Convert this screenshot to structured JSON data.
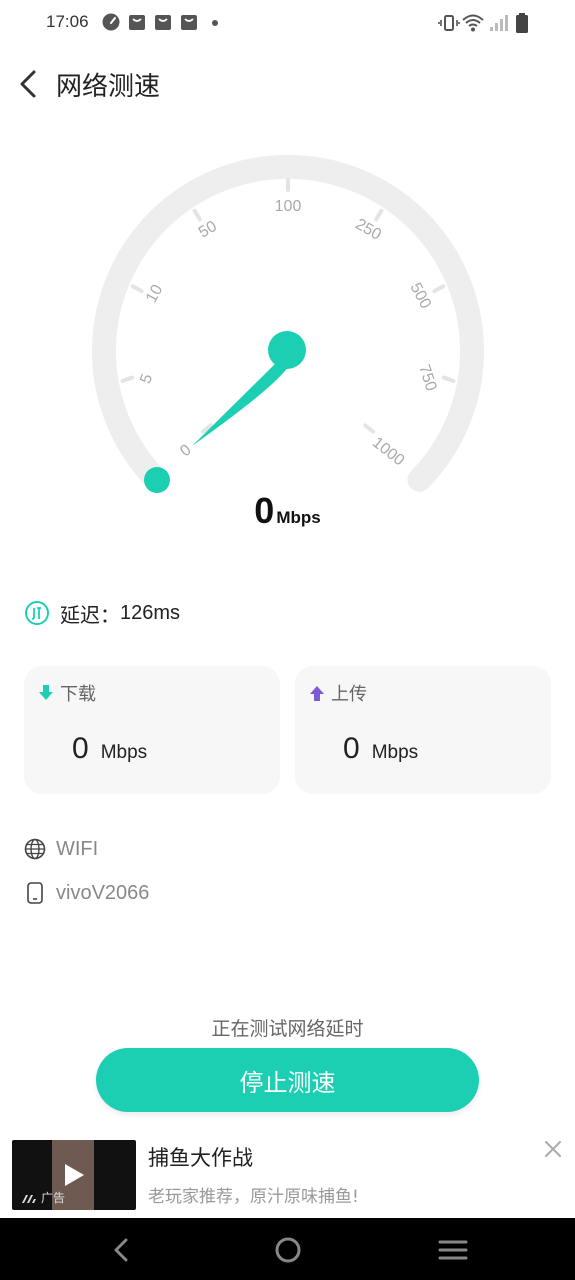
{
  "status_bar": {
    "time": "17:06",
    "left_icons": [
      "speedometer-icon",
      "notification-bag-icon",
      "notification-bag-icon",
      "notification-bag-icon",
      "dot-icon"
    ],
    "right_icons": [
      "vibrate-icon",
      "wifi-icon",
      "signal-icon",
      "battery-icon"
    ]
  },
  "header": {
    "title": "网络测速",
    "back_icon": "chevron-left-icon"
  },
  "gauge": {
    "ticks": [
      "0",
      "5",
      "10",
      "50",
      "100",
      "250",
      "500",
      "750",
      "1000"
    ],
    "needle_value": 0,
    "track_color": "#eeeeee",
    "accent_color": "#1ccfb2"
  },
  "speed": {
    "value": "0",
    "unit": "Mbps"
  },
  "latency": {
    "icon": "latency-icon",
    "label": "延迟：",
    "value": "126ms"
  },
  "download": {
    "icon": "download-arrow-icon",
    "label": "下载",
    "value": "0",
    "unit": "Mbps",
    "color": "#1ccfb2"
  },
  "upload": {
    "icon": "upload-arrow-icon",
    "label": "上传",
    "value": "0",
    "unit": "Mbps",
    "color": "#7b5cd6"
  },
  "network": {
    "type_icon": "globe-icon",
    "type": "WIFI",
    "device_icon": "phone-icon",
    "device": "vivoV2066"
  },
  "status_text": "正在测试网络延时",
  "stop_button": "停止测速",
  "ad": {
    "title": "捕鱼大作战",
    "subtitle": "老玩家推荐，原汁原味捕鱼!",
    "badge": "广告"
  },
  "nav": {
    "back_icon": "nav-back-icon",
    "home_icon": "nav-home-icon",
    "menu_icon": "nav-menu-icon"
  }
}
